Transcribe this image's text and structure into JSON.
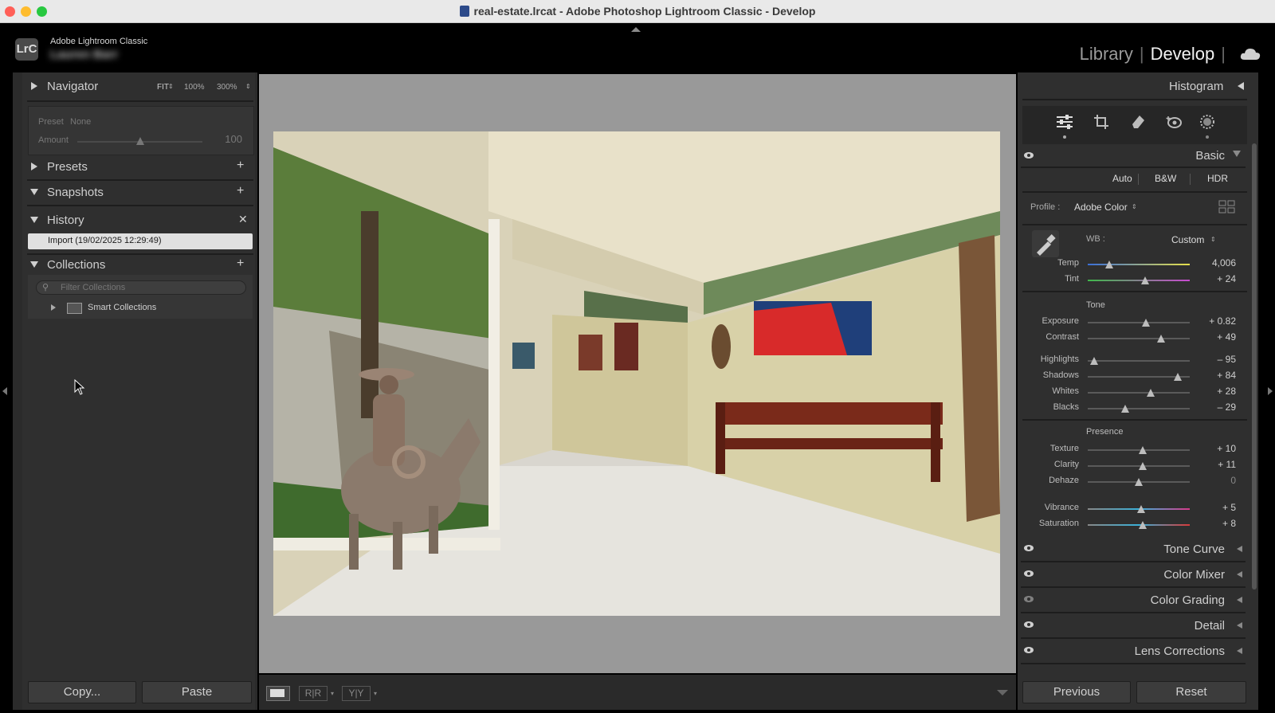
{
  "window": {
    "title": "real-estate.lrcat - Adobe Photoshop Lightroom Classic - Develop"
  },
  "identity": {
    "logo": "LrC",
    "app_name": "Adobe Lightroom Classic",
    "user_name": "Lauren Barr"
  },
  "modules": {
    "library": "Library",
    "develop": "Develop",
    "active": "Develop"
  },
  "left": {
    "navigator": {
      "title": "Navigator",
      "fit": "FIT",
      "z100": "100%",
      "z300": "300%"
    },
    "preview": {
      "preset_label": "Preset",
      "preset_value": "None",
      "amount_label": "Amount",
      "amount_value": "100",
      "amount_level": 0.5
    },
    "presets": {
      "title": "Presets"
    },
    "snapshots": {
      "title": "Snapshots"
    },
    "history": {
      "title": "History",
      "items": [
        "Import (19/02/2025 12:29:49)"
      ]
    },
    "collections": {
      "title": "Collections",
      "filter_placeholder": "Filter Collections",
      "items": [
        "Smart Collections"
      ]
    },
    "copy_label": "Copy...",
    "paste_label": "Paste"
  },
  "right": {
    "histogram_title": "Histogram",
    "tools": [
      "sliders-icon",
      "crop-icon",
      "eraser-icon",
      "red-eye-icon",
      "mask-icon"
    ],
    "basic": {
      "title": "Basic",
      "modes": [
        "Auto",
        "B&W",
        "HDR"
      ],
      "profile_label": "Profile :",
      "profile_value": "Adobe Color",
      "wb_label": "WB :",
      "wb_value": "Custom",
      "sections": {
        "tone": "Tone",
        "presence": "Presence"
      },
      "sliders": [
        {
          "label": "Temp",
          "value": "4,006",
          "level": 0.21
        },
        {
          "label": "Tint",
          "value": "+ 24",
          "level": 0.56
        },
        {
          "label": "Exposure",
          "value": "+ 0.82",
          "level": 0.57
        },
        {
          "label": "Contrast",
          "value": "+ 49",
          "level": 0.72
        },
        {
          "label": "Highlights",
          "value": "– 95",
          "level": 0.06
        },
        {
          "label": "Shadows",
          "value": "+ 84",
          "level": 0.88
        },
        {
          "label": "Whites",
          "value": "+ 28",
          "level": 0.62
        },
        {
          "label": "Blacks",
          "value": "– 29",
          "level": 0.37
        },
        {
          "label": "Texture",
          "value": "+ 10",
          "level": 0.54
        },
        {
          "label": "Clarity",
          "value": "+ 11",
          "level": 0.54
        },
        {
          "label": "Dehaze",
          "value": "0",
          "level": 0.5
        },
        {
          "label": "Vibrance",
          "value": "+ 5",
          "level": 0.52
        },
        {
          "label": "Saturation",
          "value": "+ 8",
          "level": 0.54
        }
      ]
    },
    "panels": [
      "Tone Curve",
      "Color Mixer",
      "Color Grading",
      "Detail",
      "Lens Corrections"
    ],
    "previous_label": "Previous",
    "reset_label": "Reset"
  },
  "colors": {
    "accent_text": "#f2f2f2",
    "panel_bg": "#2f2f2f",
    "center_bg": "#999999"
  }
}
